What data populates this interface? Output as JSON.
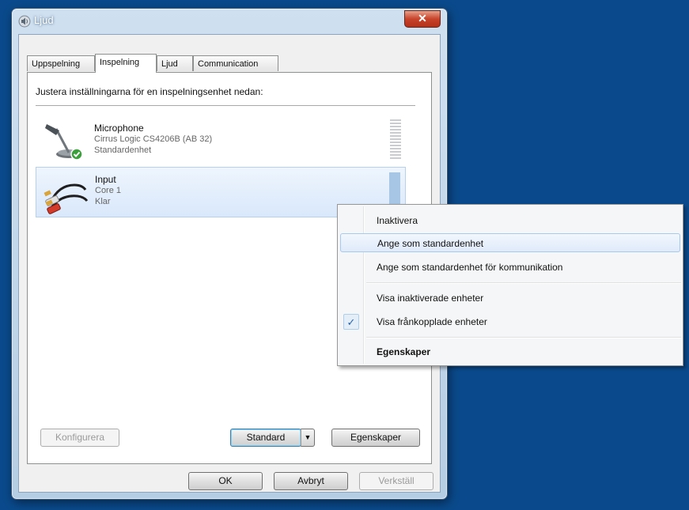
{
  "window": {
    "title": "Ljud",
    "close_glyph": "✕"
  },
  "tabs": [
    {
      "label": "Uppspelning"
    },
    {
      "label": "Inspelning",
      "active": true
    },
    {
      "label": "Ljud"
    },
    {
      "label": "Communication"
    }
  ],
  "instruction": "Justera inställningarna för en inspelningsenhet nedan:",
  "devices": [
    {
      "name": "Microphone",
      "description": "Cirrus Logic CS4206B (AB 32)",
      "status": "Standardenhet",
      "icon": "microphone-icon",
      "badge": "✓",
      "selected": false
    },
    {
      "name": "Input",
      "description": "Core 1",
      "status": "Klar",
      "icon": "rca-cable-icon",
      "selected": true
    }
  ],
  "buttons": {
    "configure": "Konfigurera",
    "standard": "Standard",
    "standard_arrow": "▼",
    "properties": "Egenskaper",
    "ok": "OK",
    "cancel": "Avbryt",
    "apply": "Verkställ"
  },
  "context_menu": {
    "items": [
      {
        "label": "Inaktivera",
        "bold": false
      },
      {
        "label": "Ange som standardenhet",
        "hover": true
      },
      {
        "label": "Ange som standardenhet för kommunikation"
      },
      {
        "label": "Visa inaktiverade enheter"
      },
      {
        "label": "Visa frånkopplade enheter",
        "checked": true,
        "check_glyph": "✓"
      },
      {
        "label": "Egenskaper",
        "bold": true
      }
    ]
  },
  "colors": {
    "desktop": "#0a4a8c",
    "selection": "#d9e8fb",
    "accent": "#3c7fb1"
  }
}
